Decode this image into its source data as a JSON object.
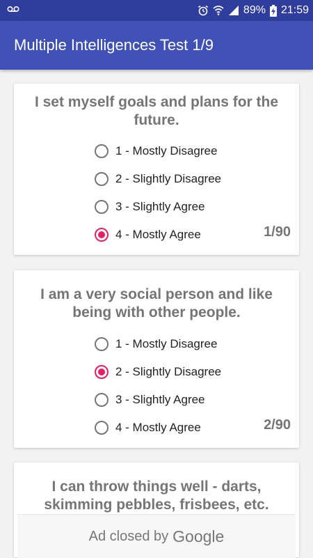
{
  "status_bar": {
    "battery_percent": "89%",
    "time": "21:59"
  },
  "app_bar": {
    "title": "Multiple Intelligences Test 1/9"
  },
  "questions": [
    {
      "text": "I set myself goals and plans for the future.",
      "options": [
        "1 - Mostly Disagree",
        "2 - Slightly Disagree",
        "3 - Slightly Agree",
        "4 - Mostly Agree"
      ],
      "selected": 3,
      "counter": "1/90"
    },
    {
      "text": "I am a very social person and like being with other people.",
      "options": [
        "1 - Mostly Disagree",
        "2 - Slightly Disagree",
        "3 - Slightly Agree",
        "4 - Mostly Agree"
      ],
      "selected": 1,
      "counter": "2/90"
    },
    {
      "text": "I can throw things well - darts, skimming pebbles, frisbees, etc."
    }
  ],
  "ad_banner": {
    "text": "Ad closed by",
    "brand": "Google"
  },
  "colors": {
    "app_bar": "#3f51b5",
    "status_bar": "#2f3e9e",
    "accent": "#e91e63",
    "text_gray": "#757575"
  }
}
